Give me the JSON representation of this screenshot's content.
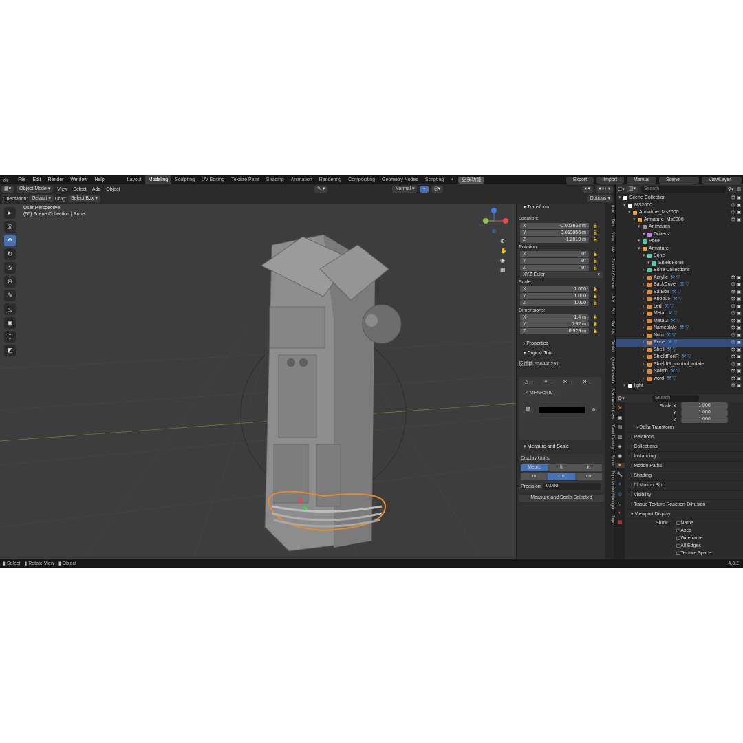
{
  "menu": [
    "File",
    "Edit",
    "Render",
    "Window",
    "Help"
  ],
  "workspaces": [
    "Layout",
    "Modeling",
    "Sculpting",
    "UV Editing",
    "Texture Paint",
    "Shading",
    "Animation",
    "Rendering",
    "Compositing",
    "Geometry Nodes",
    "Scripting"
  ],
  "active_workspace": "Modeling",
  "add_workspace": "+",
  "extra_tab": "更多功能",
  "top_right": {
    "export": "Export",
    "import": "Import",
    "manual": "Manual",
    "scene": "Scene",
    "view_layer": "ViewLayer"
  },
  "viewport_header": {
    "mode": "Object Mode",
    "menus": [
      "View",
      "Select",
      "Add",
      "Object"
    ],
    "shading": "Normal",
    "options": "Options"
  },
  "viewport_header2": {
    "orientation_label": "Orientation:",
    "orientation": "Default",
    "drag_label": "Drag:",
    "drag": "Select Box"
  },
  "viewport_overlay": {
    "view_name": "User Perspective",
    "collection": "(55) Scene Collection | Rope"
  },
  "transform": {
    "title": "Transform",
    "location_label": "Location:",
    "location": [
      {
        "axis": "X",
        "value": "-0.003632 m"
      },
      {
        "axis": "Y",
        "value": "0.052056 m"
      },
      {
        "axis": "Z",
        "value": "-1.2019 m"
      }
    ],
    "rotation_label": "Rotation:",
    "rotation": [
      {
        "axis": "X",
        "value": "0°"
      },
      {
        "axis": "Y",
        "value": "0°"
      },
      {
        "axis": "Z",
        "value": "0°"
      }
    ],
    "rotation_mode": "XYZ Euler",
    "scale_label": "Scale:",
    "scale": [
      {
        "axis": "X",
        "value": "1.000"
      },
      {
        "axis": "Y",
        "value": "1.000"
      },
      {
        "axis": "Z",
        "value": "1.000"
      }
    ],
    "dimensions_label": "Dimensions:",
    "dimensions": [
      {
        "axis": "X",
        "value": "1.4 m"
      },
      {
        "axis": "Y",
        "value": "0.92 m"
      },
      {
        "axis": "Z",
        "value": "0.529 m"
      }
    ]
  },
  "properties_section": "Properties",
  "cupcko": {
    "title": "CupckoTool",
    "feedback": "反馈群:536440291",
    "mesh_uv": "MESH>UV"
  },
  "measure": {
    "title": "Measure and Scale",
    "display_units_label": "Display Units:",
    "units1": [
      "Metric",
      "ft",
      "in"
    ],
    "units2": [
      "m",
      "cm",
      "mm"
    ],
    "precision_label": "Precision:",
    "precision": "0.000",
    "button": "Measure and Scale Selected"
  },
  "side_tabs": [
    "Item",
    "Tool",
    "View",
    "AM",
    "Zen UV Checker",
    "UVV",
    "Edit",
    "Zen UV",
    "Toolkit",
    "QuadRemesh",
    "Screencast Keys",
    "Texel Density",
    "Rodin",
    "Tripo Model Manager",
    "Tripo"
  ],
  "outliner": {
    "search_placeholder": "Search",
    "rows": [
      {
        "name": "Scene Collection",
        "indent": 0,
        "icon": "collection"
      },
      {
        "name": "MS2000",
        "indent": 1,
        "icon": "collection"
      },
      {
        "name": "Armature_Ms2000",
        "indent": 2,
        "icon": "armature"
      },
      {
        "name": "Armature_Ms2000",
        "indent": 3,
        "icon": "armature"
      },
      {
        "name": "Animation",
        "indent": 4,
        "icon": "anim"
      },
      {
        "name": "Drivers",
        "indent": 5,
        "icon": "driver"
      },
      {
        "name": "Pose",
        "indent": 4,
        "icon": "pose"
      },
      {
        "name": "Armature",
        "indent": 4,
        "icon": "armature"
      },
      {
        "name": "Bone",
        "indent": 5,
        "icon": "bone"
      },
      {
        "name": "ShieldForIR",
        "indent": 6,
        "icon": "bone"
      },
      {
        "name": "Bone Collections",
        "indent": 5,
        "icon": "bone"
      },
      {
        "name": "Acrylic",
        "indent": 5,
        "icon": "mesh"
      },
      {
        "name": "BackCover",
        "indent": 5,
        "icon": "mesh"
      },
      {
        "name": "BatBox",
        "indent": 5,
        "icon": "mesh"
      },
      {
        "name": "Knob05",
        "indent": 5,
        "icon": "mesh"
      },
      {
        "name": "Led",
        "indent": 5,
        "icon": "mesh"
      },
      {
        "name": "Metal",
        "indent": 5,
        "icon": "mesh"
      },
      {
        "name": "Metal2",
        "indent": 5,
        "icon": "mesh"
      },
      {
        "name": "Nameplate",
        "indent": 5,
        "icon": "mesh"
      },
      {
        "name": "Num",
        "indent": 5,
        "icon": "mesh"
      },
      {
        "name": "Rope",
        "indent": 5,
        "icon": "mesh",
        "selected": true
      },
      {
        "name": "Shell",
        "indent": 5,
        "icon": "mesh"
      },
      {
        "name": "ShieldForIR",
        "indent": 5,
        "icon": "mesh"
      },
      {
        "name": "ShieldIR_control_rotate",
        "indent": 5,
        "icon": "empty"
      },
      {
        "name": "Switch",
        "indent": 5,
        "icon": "mesh"
      },
      {
        "name": "word",
        "indent": 5,
        "icon": "mesh"
      },
      {
        "name": "light",
        "indent": 1,
        "icon": "collection"
      }
    ]
  },
  "properties": {
    "search_placeholder": "Search",
    "scale": [
      {
        "axis": "Scale X",
        "value": "1.000"
      },
      {
        "axis": "Y",
        "value": "1.000"
      },
      {
        "axis": "Z",
        "value": "1.000"
      }
    ],
    "sections": [
      "Delta Transform",
      "Relations",
      "Collections",
      "Instancing",
      "Motion Paths",
      "Shading",
      "Motion Blur",
      "Visibility",
      "Tissue Texture Reaction-Diffusion",
      "Viewport Display"
    ],
    "viewport_display": {
      "show_label": "Show",
      "items": [
        "Name",
        "Axes",
        "Wireframe",
        "All Edges",
        "Texture Space"
      ]
    }
  },
  "status": {
    "select": "Select",
    "rotate": "Rotate View",
    "object": "Object",
    "version": "4.3.2"
  },
  "colors": {
    "selection": "#334d80",
    "active_tool": "#4772b3",
    "background": "#3d3d3d",
    "accent_orange": "#e88a2a"
  }
}
